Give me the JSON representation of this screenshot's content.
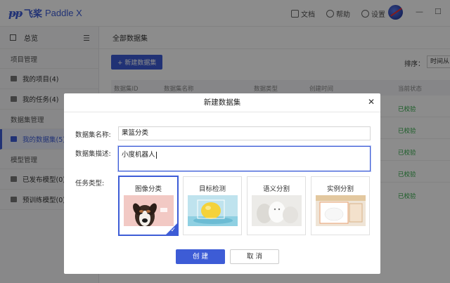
{
  "app": {
    "logo_mark": "ᵽᵽ",
    "logo_cn": "飞桨",
    "logo_en": "Paddle X"
  },
  "top_nav": {
    "docs": "文档",
    "help": "帮助",
    "settings": "设置",
    "minimize": "—",
    "restore": "☐"
  },
  "sidebar": {
    "overview": "总览",
    "groups": [
      "项目管理",
      "数据集管理",
      "模型管理"
    ],
    "items": [
      "我的项目(4)",
      "我的任务(4)",
      "我的数据集(5)",
      "已发布模型(0)",
      "预训练模型(0)"
    ]
  },
  "main": {
    "breadcrumb": "全部数据集",
    "new_button": "+ 新建数据集",
    "sort_label": "排序：",
    "sort_value": "时间从",
    "columns": [
      "数据集ID",
      "数据集名称",
      "数据类型",
      "创建时间",
      "当前状态"
    ],
    "row_statuses": [
      "已校验",
      "已校验",
      "已校验",
      "已校验",
      "已校验"
    ]
  },
  "modal": {
    "title": "新建数据集",
    "close": "✕",
    "name_label": "数据集名称:",
    "name_value": "果篮分类",
    "desc_label": "数据集描述:",
    "desc_value": "小度机器人",
    "type_label": "任务类型:",
    "types": [
      "图像分类",
      "目标检测",
      "语义分割",
      "实例分割"
    ],
    "selected_type": "图像分类",
    "create": "创 建",
    "cancel": "取 消"
  },
  "colors": {
    "accent": "#3d5cd6",
    "ok": "#2eaa45"
  }
}
